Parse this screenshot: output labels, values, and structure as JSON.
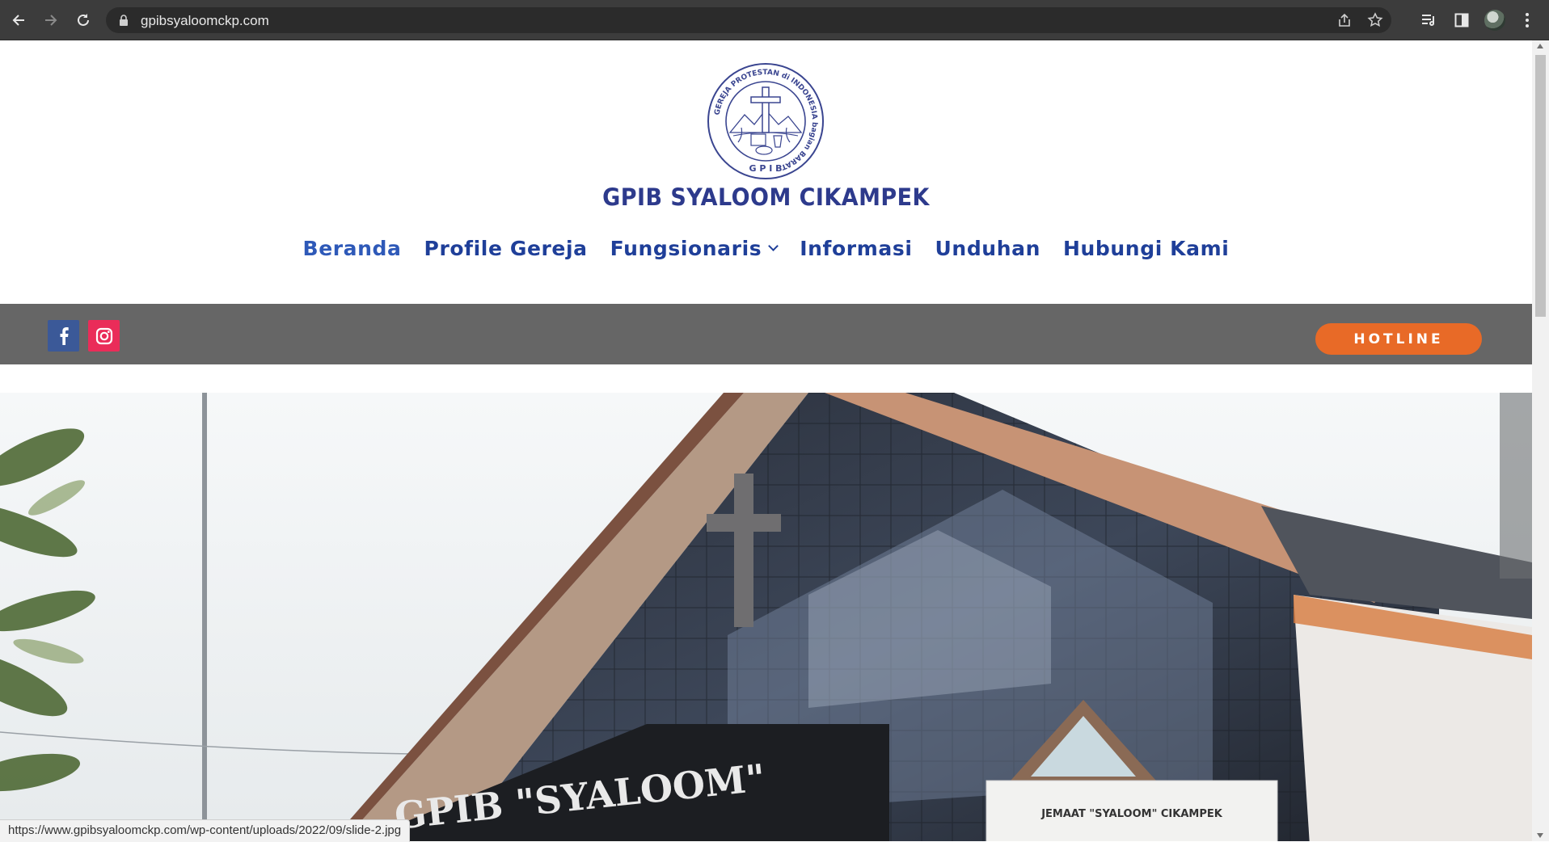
{
  "browser": {
    "url": "gpibsyaloomckp.com"
  },
  "site": {
    "title": "GPIB SYALOOM CIKAMPEK",
    "logo_ring_text": "GEREJA PROTESTAN di INDONESIA bagian BARAT",
    "logo_bottom_text": "G P I B"
  },
  "menu": {
    "items": [
      {
        "label": "Beranda"
      },
      {
        "label": "Profile Gereja"
      },
      {
        "label": "Fungsionaris"
      },
      {
        "label": "Informasi"
      },
      {
        "label": "Unduhan"
      },
      {
        "label": "Hubungi Kami"
      }
    ]
  },
  "social": {
    "hotline_label": "HOTLINE"
  },
  "hero": {
    "sign_text": "GPIB \"SYALOOM\"",
    "board_text": "JEMAAT \"SYALOOM\" CIKAMPEK"
  },
  "status_bar": {
    "link": "https://www.gpibsyaloomckp.com/wp-content/uploads/2022/09/slide-2.jpg"
  },
  "colors": {
    "menu_text": "#1f3f99",
    "title": "#2d3a8c",
    "social_bar": "#666666",
    "hotline": "#e86a27",
    "facebook": "#3b5998",
    "instagram": "#ea2c59"
  }
}
